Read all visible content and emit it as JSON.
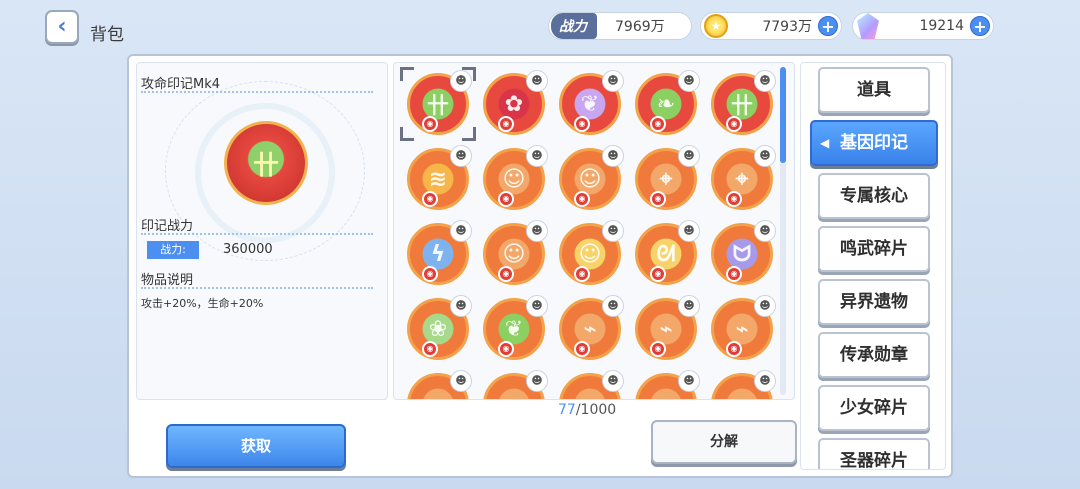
{
  "header": {
    "title": "背包",
    "power_label": "战力",
    "power_value": "7969万",
    "coins_value": "7793万",
    "gems_value": "19214"
  },
  "detail": {
    "item_name": "攻命印记Mk4",
    "power_section": "印记战力",
    "power_label": "战力:",
    "power_value": "360000",
    "desc_section": "物品说明",
    "description": "攻击+20%，生命+20%"
  },
  "grid": {
    "count_current": "77",
    "count_total": "/1000",
    "items": [
      {
        "color": "#e8493f",
        "center": "#8ccf62",
        "glyph": "卄"
      },
      {
        "color": "#e8493f",
        "center": "#d93548",
        "glyph": "✿"
      },
      {
        "color": "#e8493f",
        "center": "#c9a7f0",
        "glyph": "❦"
      },
      {
        "color": "#e8493f",
        "center": "#8ccf62",
        "glyph": "❧"
      },
      {
        "color": "#e8493f",
        "center": "#8ccf62",
        "glyph": "卄"
      },
      {
        "color": "#f07a3c",
        "center": "#f7b64a",
        "glyph": "≋"
      },
      {
        "color": "#f07a3c",
        "center": "#f3a86a",
        "glyph": "☺"
      },
      {
        "color": "#f07a3c",
        "center": "#f3a86a",
        "glyph": "☺"
      },
      {
        "color": "#f07a3c",
        "center": "#f3a86a",
        "glyph": "⌖"
      },
      {
        "color": "#f07a3c",
        "center": "#f3a86a",
        "glyph": "⌖"
      },
      {
        "color": "#f07a3c",
        "center": "#7fb3f0",
        "glyph": "ϟ"
      },
      {
        "color": "#f07a3c",
        "center": "#f3a86a",
        "glyph": "☺"
      },
      {
        "color": "#f07a3c",
        "center": "#f7d36a",
        "glyph": "☺"
      },
      {
        "color": "#f07a3c",
        "center": "#f7d36a",
        "glyph": "ᘛ"
      },
      {
        "color": "#f07a3c",
        "center": "#a79ae8",
        "glyph": "ᗢ"
      },
      {
        "color": "#f07a3c",
        "center": "#a7d98a",
        "glyph": "❀"
      },
      {
        "color": "#f07a3c",
        "center": "#8ccf62",
        "glyph": "❦"
      },
      {
        "color": "#f07a3c",
        "center": "#f3a86a",
        "glyph": "⌁"
      },
      {
        "color": "#f07a3c",
        "center": "#f3a86a",
        "glyph": "⌁"
      },
      {
        "color": "#f07a3c",
        "center": "#f3a86a",
        "glyph": "⌁"
      },
      {
        "color": "#f07a3c",
        "center": "#f3a86a",
        "glyph": ""
      },
      {
        "color": "#f07a3c",
        "center": "#f3a86a",
        "glyph": ""
      },
      {
        "color": "#f07a3c",
        "center": "#f3a86a",
        "glyph": ""
      },
      {
        "color": "#f07a3c",
        "center": "#f3a86a",
        "glyph": ""
      },
      {
        "color": "#f07a3c",
        "center": "#f3a86a",
        "glyph": ""
      }
    ]
  },
  "buttons": {
    "get_label": "获取",
    "decompose_label": "分解"
  },
  "categories": [
    {
      "label": "道具",
      "active": false
    },
    {
      "label": "基因印记",
      "active": true
    },
    {
      "label": "专属核心",
      "active": false
    },
    {
      "label": "鸣武碎片",
      "active": false
    },
    {
      "label": "异界遗物",
      "active": false
    },
    {
      "label": "传承勋章",
      "active": false
    },
    {
      "label": "少女碎片",
      "active": false
    },
    {
      "label": "圣器碎片",
      "active": false
    }
  ],
  "colors": {
    "accent": "#4d8ff0",
    "background": "#d9e6f6"
  }
}
